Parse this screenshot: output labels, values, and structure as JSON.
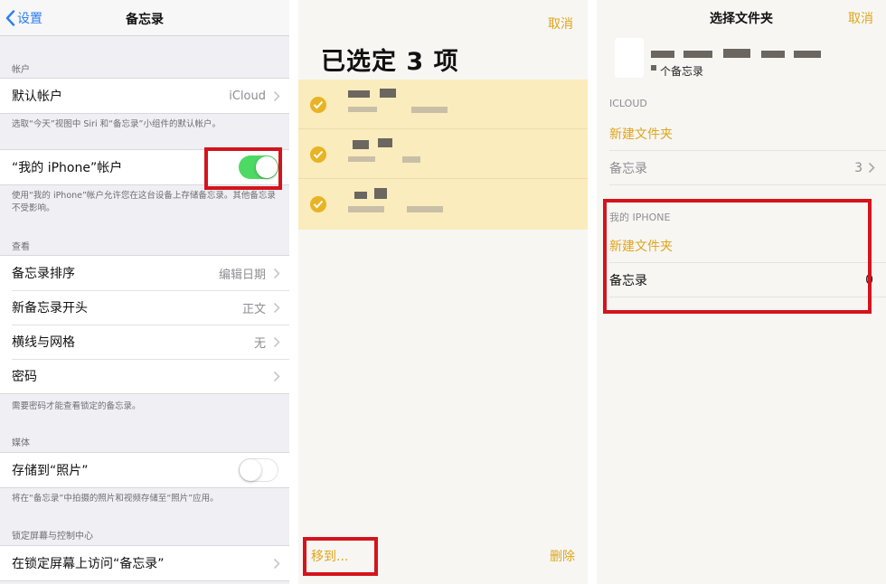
{
  "settings": {
    "back_label": "设置",
    "title": "备忘录",
    "accounts_header": "帐户",
    "default_account_label": "默认帐户",
    "default_account_value": "iCloud",
    "default_account_footer": "选取“今天”视图中 Siri 和“备忘录”小组件的默认帐户。",
    "my_iphone_label": "“我的 iPhone”帐户",
    "my_iphone_toggle": true,
    "my_iphone_footer": "使用“我的 iPhone”帐户允许您在这台设备上存储备忘录。其他备忘录不受影响。",
    "view_header": "查看",
    "sort_label": "备忘录排序",
    "sort_value": "编辑日期",
    "new_start_label": "新备忘录开头",
    "new_start_value": "正文",
    "lines_label": "横线与网格",
    "lines_value": "无",
    "password_label": "密码",
    "password_footer": "需要密码才能查看锁定的备忘录。",
    "media_header": "媒体",
    "save_photos_label": "存储到“照片”",
    "save_photos_toggle": false,
    "save_photos_footer": "将在“备忘录”中拍摄的照片和视频存储至“照片”应用。",
    "lock_header": "锁定屏幕与控制中心",
    "lock_access_label": "在锁定屏幕上访问“备忘录”"
  },
  "selection": {
    "cancel": "取消",
    "title": "已选定 3 项",
    "move": "移到...",
    "delete": "删除"
  },
  "folder_picker": {
    "title": "选择文件夹",
    "cancel": "取消",
    "count_text": "个备忘录",
    "icloud_header": "ICLOUD",
    "icloud_new_folder": "新建文件夹",
    "icloud_notes_label": "备忘录",
    "icloud_notes_count": "3",
    "iphone_header": "我的 IPHONE",
    "iphone_new_folder": "新建文件夹",
    "iphone_notes_label": "备忘录",
    "iphone_notes_count": "0"
  },
  "colors": {
    "ios_blue": "#2a7ef5",
    "notes_yellow": "#e0a51c",
    "toggle_green": "#4cd964",
    "highlight_red": "#d4141c",
    "selected_row": "#faecbc"
  }
}
